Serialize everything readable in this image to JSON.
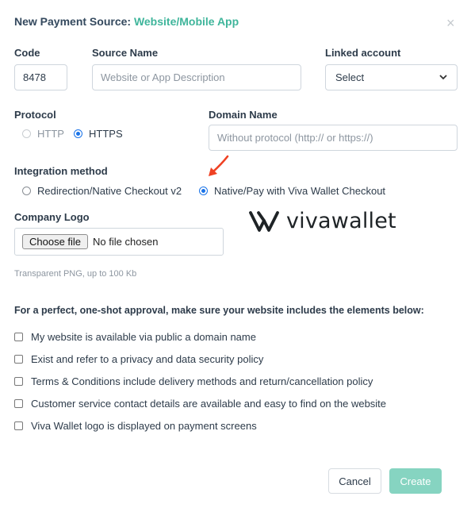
{
  "modal": {
    "title_prefix": "New Payment Source: ",
    "title_accent": "Website/Mobile App",
    "close_glyph": "×"
  },
  "code": {
    "label": "Code",
    "value": "8478"
  },
  "source_name": {
    "label": "Source Name",
    "placeholder": "Website or App Description"
  },
  "linked_account": {
    "label": "Linked account",
    "selected": "Select"
  },
  "protocol": {
    "label": "Protocol",
    "options": [
      {
        "label": "HTTP",
        "checked": false,
        "disabled": true
      },
      {
        "label": "HTTPS",
        "checked": true,
        "disabled": false
      }
    ]
  },
  "domain_name": {
    "label": "Domain Name",
    "placeholder": "Without protocol (http:// or https://)"
  },
  "integration": {
    "label": "Integration method",
    "options": [
      {
        "label": "Redirection/Native Checkout v2",
        "checked": false
      },
      {
        "label": "Native/Pay with Viva Wallet Checkout",
        "checked": true
      }
    ]
  },
  "company_logo": {
    "label": "Company Logo",
    "choose_button": "Choose file",
    "file_status": "No file chosen",
    "hint": "Transparent PNG, up to 100 Kb"
  },
  "brand": {
    "name": "vivawallet"
  },
  "requirements": {
    "intro": "For a perfect, one-shot approval, make sure your website includes the elements below:",
    "items": [
      "My website is available via public a domain name",
      "Exist and refer to a privacy and data security policy",
      "Terms & Conditions include delivery methods and return/cancellation policy",
      "Customer service contact details are available and easy to find on the website",
      "Viva Wallet logo is displayed on payment screens"
    ]
  },
  "actions": {
    "cancel": "Cancel",
    "create": "Create"
  },
  "colors": {
    "accent": "#3fb59b",
    "create_button": "#86d4c1",
    "radio_selected": "#1a73e8",
    "annotation_arrow": "#ef4123"
  }
}
